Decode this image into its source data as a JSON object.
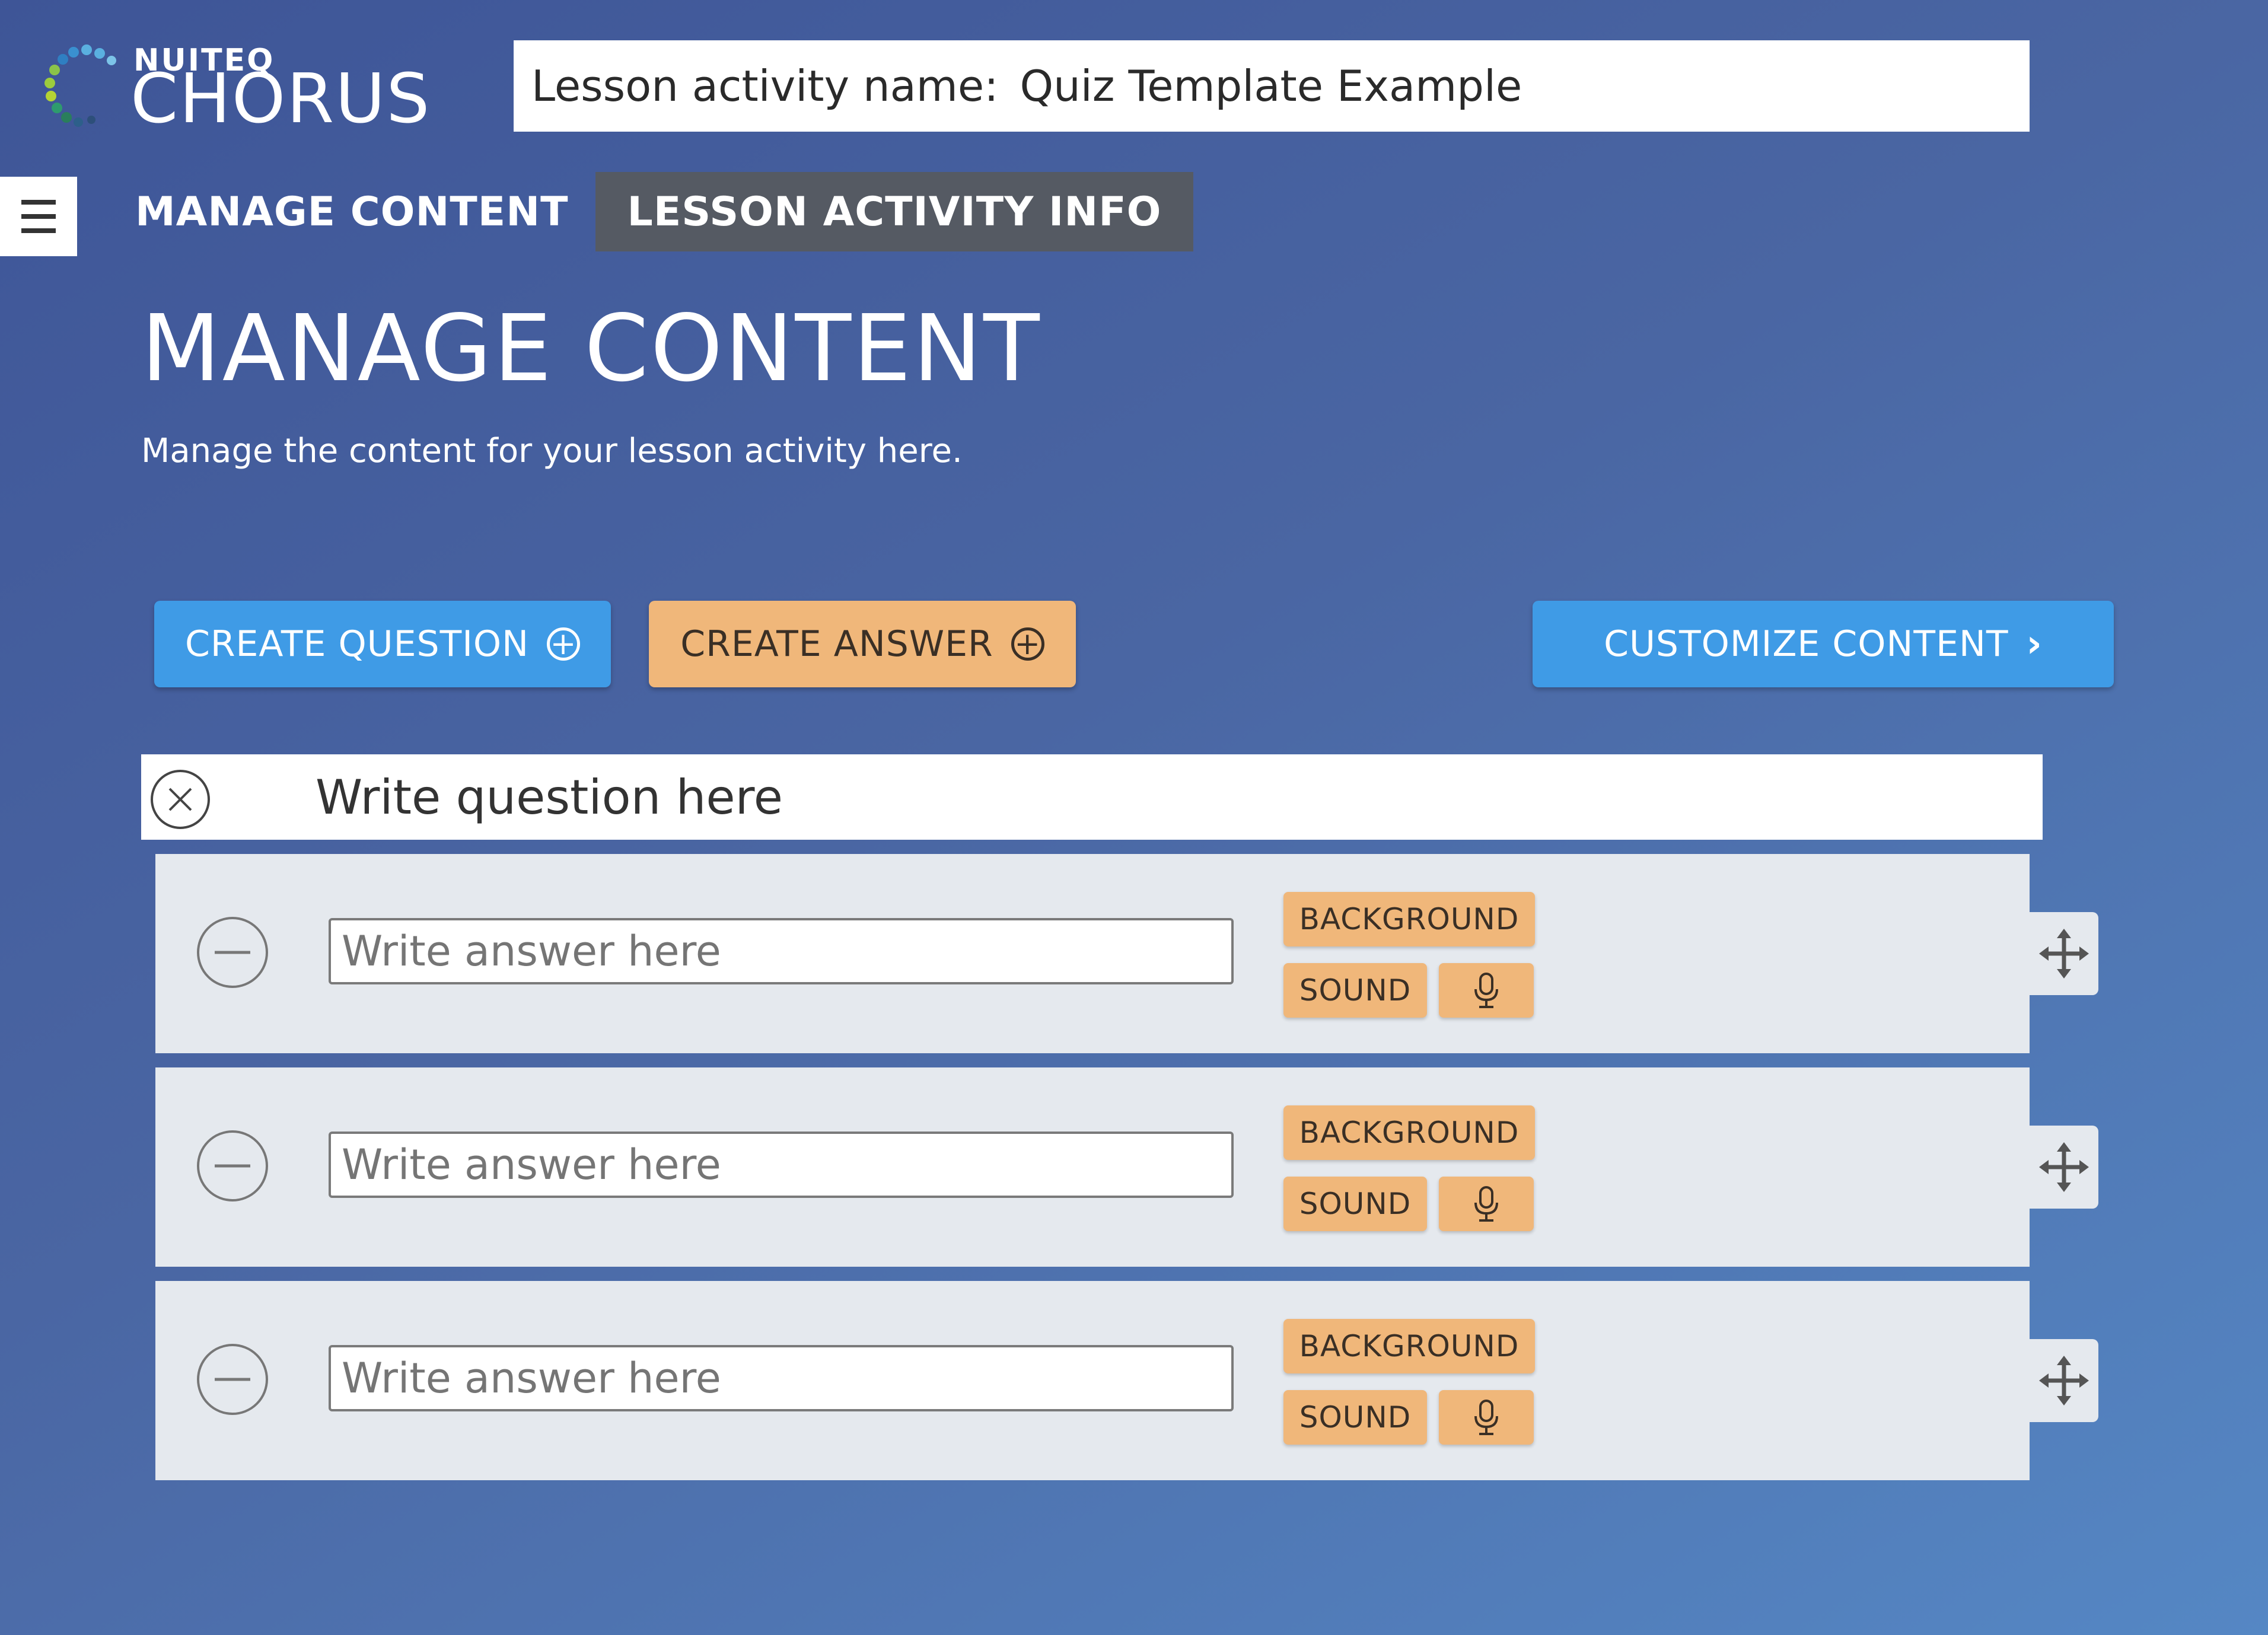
{
  "app": {
    "brand": "NUITEQ",
    "product": "CHORUS"
  },
  "activity": {
    "label": "Lesson activity name:",
    "name": "Quiz Template Example"
  },
  "tabs": [
    {
      "label": "MANAGE CONTENT"
    },
    {
      "label": "LESSON ACTIVITY INFO"
    }
  ],
  "page": {
    "title": "MANAGE CONTENT",
    "subtitle": "Manage the content for your lesson activity here."
  },
  "buttons": {
    "create_question": "CREATE QUESTION",
    "create_answer": "CREATE ANSWER",
    "customize_content": "CUSTOMIZE CONTENT"
  },
  "question": {
    "placeholder": "Write question here"
  },
  "answers": [
    {
      "placeholder": "Write answer here",
      "background_label": "BACKGROUND",
      "sound_label": "SOUND"
    },
    {
      "placeholder": "Write answer here",
      "background_label": "BACKGROUND",
      "sound_label": "SOUND"
    },
    {
      "placeholder": "Write answer here",
      "background_label": "BACKGROUND",
      "sound_label": "SOUND"
    }
  ],
  "icons": {
    "menu": "hamburger-icon",
    "add": "plus-circle-icon",
    "next": "chevron-right-icon",
    "remove_question": "close-circle-icon",
    "remove_answer": "minus-circle-icon",
    "record": "microphone-icon",
    "reorder": "move-icon"
  },
  "colors": {
    "primary_button": "#3f9be6",
    "accent_button": "#f0b77a",
    "active_tab": "#555a63",
    "background_start": "#3e5597",
    "background_end": "#5587c4"
  }
}
